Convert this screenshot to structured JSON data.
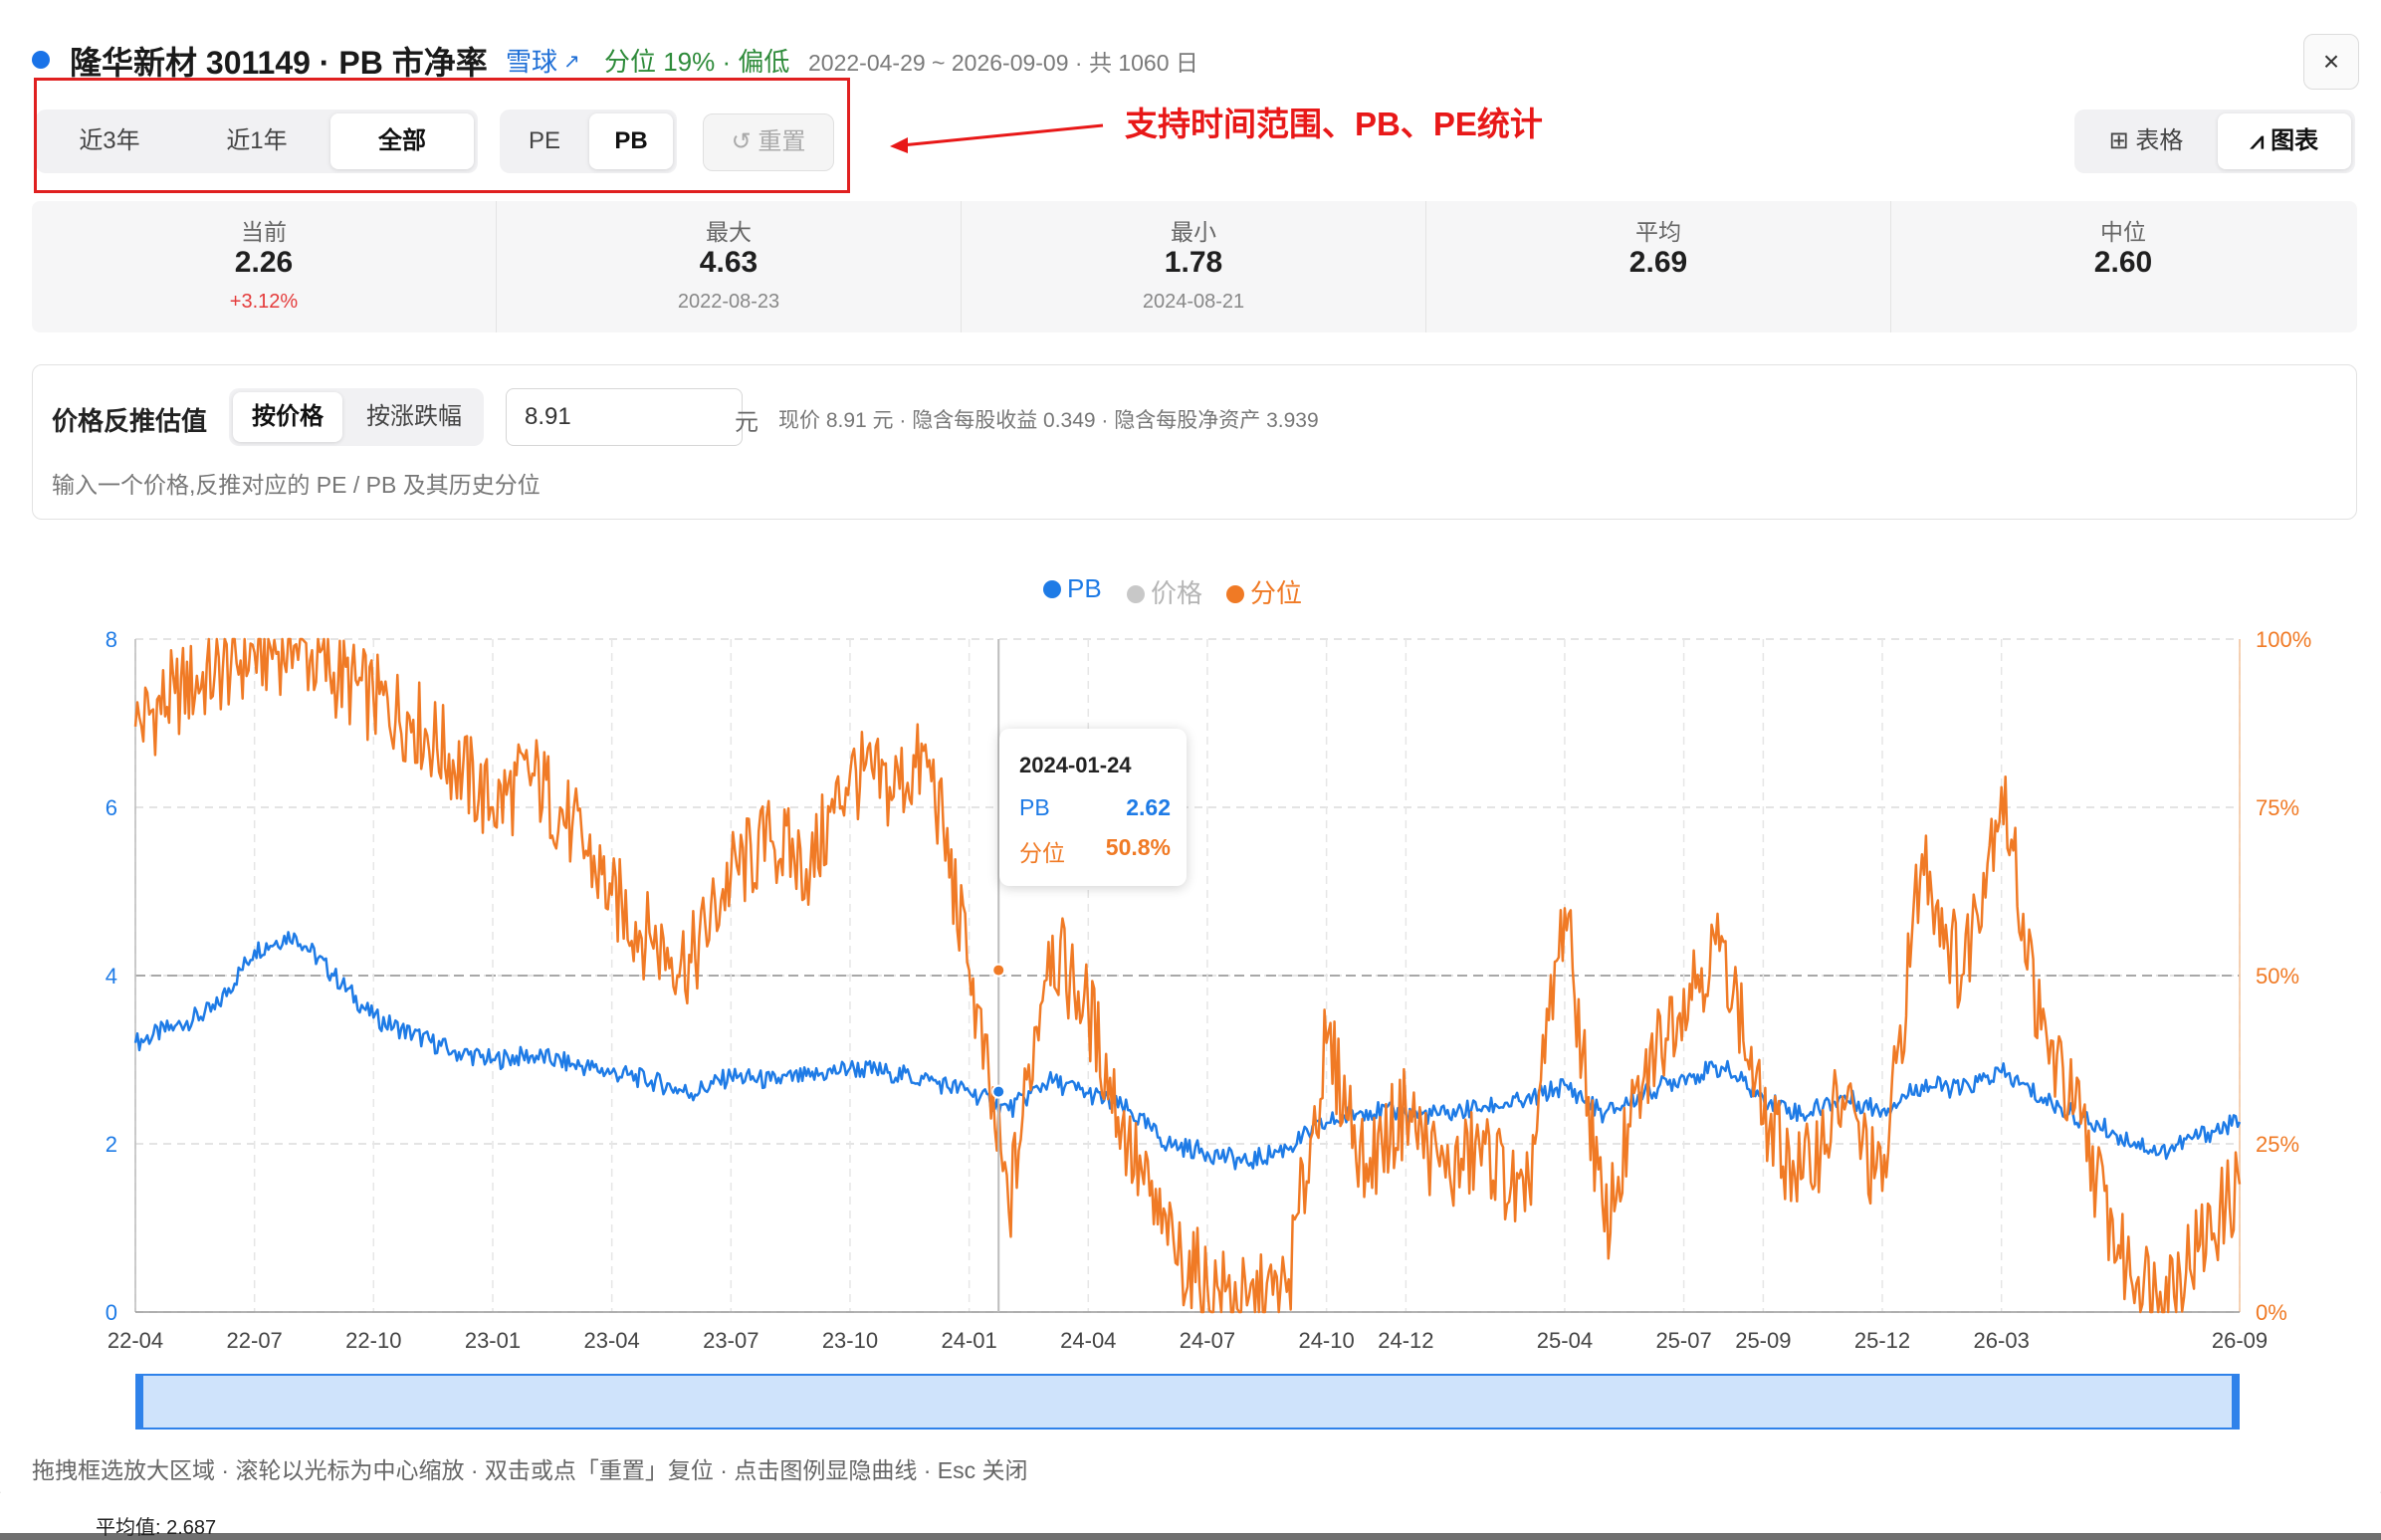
{
  "header": {
    "title": "隆华新材 301149 · PB 市净率",
    "xueqiu_link": "雪球",
    "percentile_text": "分位 19% · 偏低",
    "range_text": "2022-04-29 ~ 2026-09-09 · 共 1060 日",
    "close_label": "×"
  },
  "controls": {
    "period": [
      "近3年",
      "近1年",
      "全部"
    ],
    "period_active": "全部",
    "metric": [
      "PE",
      "PB"
    ],
    "metric_active": "PB",
    "reset_label": "重置",
    "views": [
      {
        "icon": "table-icon",
        "label": "表格"
      },
      {
        "icon": "chart-icon",
        "label": "图表"
      }
    ],
    "view_active": "图表"
  },
  "annotation": {
    "text": "支持时间范围、PB、PE统计",
    "color": "#e81818"
  },
  "stats": [
    {
      "label": "当前",
      "value": "2.26",
      "sub": "+3.12%"
    },
    {
      "label": "最大",
      "value": "4.63",
      "sub": "2022-08-23"
    },
    {
      "label": "最小",
      "value": "1.78",
      "sub": "2024-08-21"
    },
    {
      "label": "平均",
      "value": "2.69",
      "sub": ""
    },
    {
      "label": "中位",
      "value": "2.60",
      "sub": ""
    }
  ],
  "price_reverse": {
    "label": "价格反推估值",
    "modes": [
      "按价格",
      "按涨跌幅"
    ],
    "mode_active": "按价格",
    "input_value": "8.91",
    "unit": "元",
    "info": "现价 8.91 元 · 隐含每股收益 0.349 · 隐含每股净资产 3.939",
    "hint": "输入一个价格,反推对应的 PE / PB 及其历史分位"
  },
  "legend": [
    {
      "name": "PB",
      "color": "#1e7be6"
    },
    {
      "name": "价格",
      "color": "#c8c8c8"
    },
    {
      "name": "分位",
      "color": "#f07a25"
    }
  ],
  "tooltip": {
    "date": "2024-01-24",
    "rows": [
      {
        "name": "PB",
        "value": "2.62",
        "color": "#1e7be6"
      },
      {
        "name": "分位",
        "value": "50.8%",
        "color": "#f07a25"
      }
    ]
  },
  "footer_hint": "拖拽框选放大区域 · 滚轮以光标为中心缩放 · 双击或点「重置」复位 · 点击图例显隐曲线 · Esc 关闭",
  "background_text": "平均值: 2.687",
  "chart_data": {
    "type": "line",
    "x_ticks": [
      "22-04",
      "22-07",
      "22-10",
      "23-01",
      "23-04",
      "23-07",
      "23-10",
      "24-01",
      "24-04",
      "24-07",
      "24-10",
      "24-12",
      "25-04",
      "25-07",
      "25-09",
      "25-12",
      "26-03",
      "26-09"
    ],
    "y_left": {
      "ticks": [
        "0",
        "2",
        "4",
        "6",
        "8"
      ],
      "range": [
        0,
        8
      ],
      "color": "#1e7be6"
    },
    "y_right": {
      "ticks": [
        "0%",
        "25%",
        "50%",
        "75%",
        "100%"
      ],
      "range": [
        0,
        100
      ],
      "color": "#f07a25"
    },
    "reference_line": {
      "axis": "left",
      "value": 4
    },
    "cursor_date": "2024-01-24",
    "series": [
      {
        "name": "PB",
        "axis": "left",
        "color": "#1e7be6",
        "points": [
          [
            "22-04",
            3.2
          ],
          [
            "22-05",
            3.4
          ],
          [
            "22-06",
            3.6
          ],
          [
            "22-07",
            4.3
          ],
          [
            "22-08",
            4.5
          ],
          [
            "22-09",
            4.0
          ],
          [
            "22-10",
            3.5
          ],
          [
            "22-11",
            3.3
          ],
          [
            "22-12",
            3.1
          ],
          [
            "23-01",
            3.0
          ],
          [
            "23-02",
            3.05
          ],
          [
            "23-03",
            2.95
          ],
          [
            "23-04",
            2.85
          ],
          [
            "23-05",
            2.75
          ],
          [
            "23-06",
            2.6
          ],
          [
            "23-07",
            2.8
          ],
          [
            "23-08",
            2.75
          ],
          [
            "23-09",
            2.8
          ],
          [
            "23-10",
            2.9
          ],
          [
            "23-11",
            2.85
          ],
          [
            "23-12",
            2.75
          ],
          [
            "24-01",
            2.62
          ],
          [
            "24-02",
            2.4
          ],
          [
            "24-03",
            2.75
          ],
          [
            "24-04",
            2.6
          ],
          [
            "24-05",
            2.4
          ],
          [
            "24-06",
            2.0
          ],
          [
            "24-07",
            1.9
          ],
          [
            "24-08",
            1.78
          ],
          [
            "24-09",
            1.95
          ],
          [
            "24-10",
            2.25
          ],
          [
            "24-11",
            2.4
          ],
          [
            "24-12",
            2.35
          ],
          [
            "25-01",
            2.35
          ],
          [
            "25-02",
            2.45
          ],
          [
            "25-03",
            2.5
          ],
          [
            "25-04",
            2.7
          ],
          [
            "25-05",
            2.35
          ],
          [
            "25-06",
            2.6
          ],
          [
            "25-07",
            2.8
          ],
          [
            "25-08",
            2.9
          ],
          [
            "25-09",
            2.55
          ],
          [
            "25-10",
            2.35
          ],
          [
            "25-11",
            2.55
          ],
          [
            "25-12",
            2.4
          ],
          [
            "26-01",
            2.7
          ],
          [
            "26-02",
            2.65
          ],
          [
            "26-03",
            2.85
          ],
          [
            "26-04",
            2.55
          ],
          [
            "26-05",
            2.3
          ],
          [
            "26-06",
            2.1
          ],
          [
            "26-07",
            1.9
          ],
          [
            "26-08",
            2.1
          ],
          [
            "26-09",
            2.26
          ]
        ]
      },
      {
        "name": "分位",
        "axis": "right",
        "color": "#f07a25",
        "points": [
          [
            "22-04",
            87
          ],
          [
            "22-05",
            92
          ],
          [
            "22-06",
            95
          ],
          [
            "22-07",
            98
          ],
          [
            "22-08",
            99
          ],
          [
            "22-09",
            95
          ],
          [
            "22-10",
            91
          ],
          [
            "22-11",
            88
          ],
          [
            "22-12",
            82
          ],
          [
            "23-01",
            75
          ],
          [
            "23-02",
            80
          ],
          [
            "23-03",
            72
          ],
          [
            "23-04",
            62
          ],
          [
            "23-05",
            55
          ],
          [
            "23-06",
            52
          ],
          [
            "23-07",
            65
          ],
          [
            "23-08",
            70
          ],
          [
            "23-09",
            66
          ],
          [
            "23-10",
            80
          ],
          [
            "23-11",
            78
          ],
          [
            "23-12",
            82
          ],
          [
            "24-01",
            50.8
          ],
          [
            "24-02",
            15
          ],
          [
            "24-03",
            55
          ],
          [
            "24-04",
            45
          ],
          [
            "24-05",
            25
          ],
          [
            "24-06",
            10
          ],
          [
            "24-07",
            4
          ],
          [
            "24-08",
            1
          ],
          [
            "24-09",
            3
          ],
          [
            "24-10",
            40
          ],
          [
            "24-11",
            22
          ],
          [
            "24-12",
            30
          ],
          [
            "25-01",
            20
          ],
          [
            "25-02",
            25
          ],
          [
            "25-03",
            15
          ],
          [
            "25-04",
            60
          ],
          [
            "25-05",
            12
          ],
          [
            "25-06",
            35
          ],
          [
            "25-07",
            48
          ],
          [
            "25-08",
            55
          ],
          [
            "25-09",
            28
          ],
          [
            "25-10",
            20
          ],
          [
            "25-11",
            32
          ],
          [
            "25-12",
            18
          ],
          [
            "26-01",
            68
          ],
          [
            "26-02",
            50
          ],
          [
            "26-03",
            78
          ],
          [
            "26-04",
            42
          ],
          [
            "26-05",
            28
          ],
          [
            "26-06",
            8
          ],
          [
            "26-07",
            3
          ],
          [
            "26-08",
            10
          ],
          [
            "26-09",
            19
          ]
        ]
      }
    ]
  }
}
